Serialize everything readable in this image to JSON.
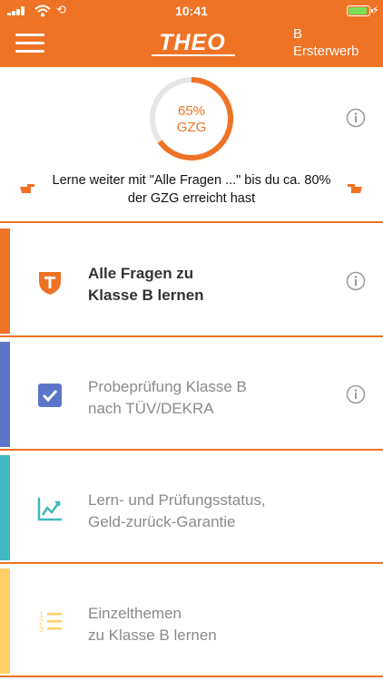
{
  "status_bar": {
    "time": "10:41"
  },
  "header": {
    "logo_text": "THEO",
    "licence_class": "B",
    "licence_type": "Ersterwerb"
  },
  "progress": {
    "percent_label": "65%",
    "unit_label": "GZG",
    "value": 0.65,
    "hint": "Lerne weiter mit \"Alle Fragen ...\" bis du ca. 80% der GZG erreicht hast"
  },
  "menu": [
    {
      "line1": "Alle Fragen zu",
      "line2": "Klasse B lernen",
      "icon": "theo-shield-icon",
      "accent": "#ef7325",
      "has_info": true
    },
    {
      "line1": "Probeprüfung Klasse B",
      "line2": "nach TÜV/DEKRA",
      "icon": "checkbox-icon",
      "accent": "#5b76c9",
      "has_info": true
    },
    {
      "line1": "Lern- und Prüfungsstatus,",
      "line2": "Geld-zurück-Garantie",
      "icon": "chart-icon",
      "accent": "#40b8bf",
      "has_info": false
    },
    {
      "line1": "Einzelthemen",
      "line2": "zu Klasse B lernen",
      "icon": "numbered-list-icon",
      "accent": "#fcd064",
      "has_info": false
    }
  ],
  "colors": {
    "brand": "#ef7325",
    "ring_track": "#e6e6e6",
    "info_icon": "#9a9a9a"
  }
}
